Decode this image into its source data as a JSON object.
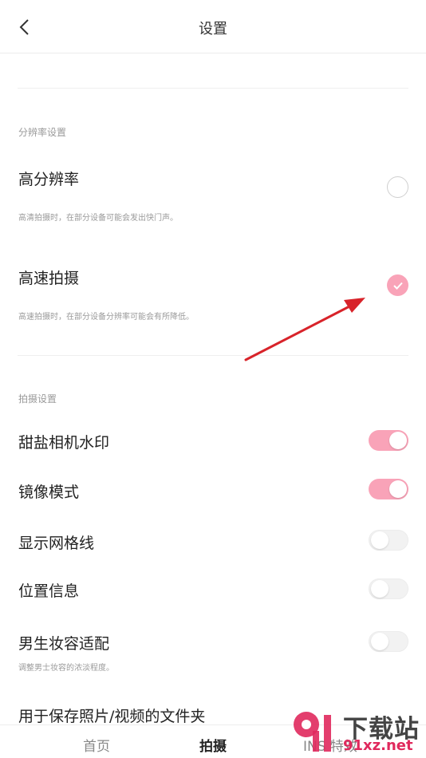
{
  "header": {
    "title": "设置"
  },
  "resolution_section": {
    "title": "分辨率设置",
    "options": [
      {
        "label": "高分辨率",
        "desc": "高清拍摄时，在部分设备可能会发出快门声。",
        "selected": false
      },
      {
        "label": "高速拍摄",
        "desc": "高速拍摄时，在部分设备分辨率可能会有所降低。",
        "selected": true
      }
    ]
  },
  "capture_section": {
    "title": "拍摄设置",
    "items": [
      {
        "label": "甜盐相机水印",
        "on": true
      },
      {
        "label": "镜像模式",
        "on": true
      },
      {
        "label": "显示网格线",
        "on": false
      },
      {
        "label": "位置信息",
        "on": false
      },
      {
        "label": "男生妆容适配",
        "desc": "调整男士妆容的浓淡程度。",
        "on": false
      },
      {
        "label": "用于保存照片/视频的文件夹"
      }
    ]
  },
  "bottom_nav": {
    "items": [
      "首页",
      "拍摄",
      "INS 特效"
    ],
    "active": 1
  },
  "watermark": {
    "text": "下载站",
    "url": "91xz.net"
  },
  "colors": {
    "accent": "#f9a3b8",
    "arrow": "#d8232a",
    "watermark_red": "#e0295d"
  }
}
